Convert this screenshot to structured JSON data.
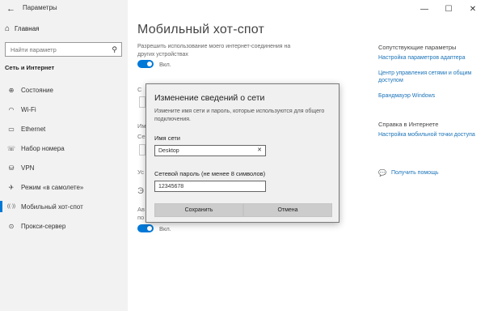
{
  "window": {
    "title": "Параметры",
    "back_glyph": "←",
    "min_glyph": "—",
    "max_glyph": "☐",
    "close_glyph": "✕"
  },
  "sidebar": {
    "home": "Главная",
    "search_placeholder": "Найти параметр",
    "category": "Сеть и Интернет",
    "items": [
      {
        "label": "Состояние",
        "icon": "⊕"
      },
      {
        "label": "Wi-Fi",
        "icon": "◠"
      },
      {
        "label": "Ethernet",
        "icon": "▭"
      },
      {
        "label": "Набор номера",
        "icon": "☏"
      },
      {
        "label": "VPN",
        "icon": "⛁"
      },
      {
        "label": "Режим «в самолете»",
        "icon": "✈"
      },
      {
        "label": "Мобильный хот-спот",
        "icon": "((·))"
      },
      {
        "label": "Прокси-сервер",
        "icon": "⊙"
      }
    ]
  },
  "main": {
    "title": "Мобильный хот-спот",
    "desc": "Разрешить использование моего интернет-соединения на других устройствах",
    "toggle1_label": "Вкл.",
    "toggle2_label": "Вкл.",
    "frag_c": "С",
    "frag_i": "Им",
    "frag_s": "Се",
    "frag_u": "Ус",
    "frag_e": "Э",
    "frag_a": "Ав",
    "frag_p": "по"
  },
  "right": {
    "related_heading": "Сопутствующие параметры",
    "related_links": [
      "Настройка параметров адаптера",
      "Центр управления сетями и общим доступом",
      "Брандмауэр Windows"
    ],
    "help_heading": "Справка в Интернете",
    "help_link": "Настройка мобильной точки доступа",
    "get_help": "Получить помощь"
  },
  "dialog": {
    "title": "Изменение сведений о сети",
    "desc": "Измените имя сети и пароль, которые используются для общего подключения.",
    "name_label": "Имя сети",
    "name_value": "Desktop",
    "password_label": "Сетевой пароль (не менее 8 символов)",
    "password_value": "12345678",
    "save": "Сохранить",
    "cancel": "Отмена"
  }
}
